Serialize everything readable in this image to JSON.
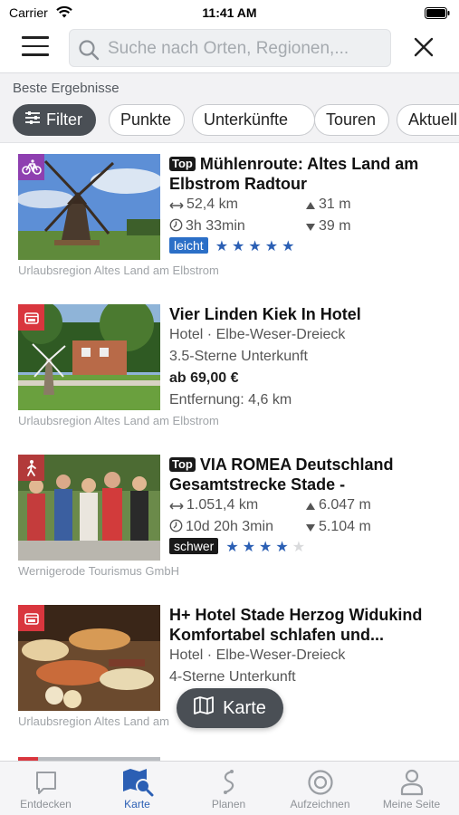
{
  "status_bar": {
    "carrier": "Carrier",
    "time": "11:41 AM"
  },
  "search": {
    "placeholder": "Suche nach Orten, Regionen,..."
  },
  "results": {
    "title": "Beste Ergebnisse",
    "chips": [
      {
        "label": "Filter",
        "active": true
      },
      {
        "label": "Punkte",
        "active": false
      },
      {
        "label": "Unterkünfte",
        "active": false
      },
      {
        "label": "Touren",
        "active": false
      },
      {
        "label": "Aktuell",
        "active": false
      }
    ]
  },
  "items": [
    {
      "kind": "tour",
      "badge_color": "#8e3fb0",
      "badge_icon": "bike-icon",
      "top": "Top",
      "title": "Mühlenroute: Altes Land am Elbstrom Radtour",
      "distance": "52,4 km",
      "duration": "3h 33min",
      "ascent": "31 m",
      "descent": "39 m",
      "difficulty": "leicht",
      "difficulty_color": "#2b6fc7",
      "rating": 5,
      "source": "Urlaubsregion Altes Land am Elbstrom"
    },
    {
      "kind": "hotel",
      "badge_color": "#d9363e",
      "badge_icon": "bed-icon",
      "title": "Vier Linden Kiek In Hotel",
      "category": "Hotel · Elbe-Weser-Dreieck",
      "stars_text": "3.5-Sterne Unterkunft",
      "price": "ab 69,00 €",
      "distance_text": "Entfernung: 4,6 km",
      "source": "Urlaubsregion Altes Land am Elbstrom"
    },
    {
      "kind": "tour",
      "badge_color": "#b23a3a",
      "badge_icon": "hiker-icon",
      "top": "Top",
      "title": "VIA ROMEA Deutschland Gesamtstrecke Stade -",
      "distance": "1.051,4 km",
      "duration": "10d 20h 3min",
      "ascent": "6.047 m",
      "descent": "5.104 m",
      "difficulty": "schwer",
      "difficulty_color": "#1a1a1a",
      "rating": 4,
      "source": "Wernigerode Tourismus GmbH"
    },
    {
      "kind": "hotel",
      "badge_color": "#d9363e",
      "badge_icon": "bed-icon",
      "title": "H+ Hotel Stade Herzog Widukind Komfortabel schlafen und...",
      "category": "Hotel · Elbe-Weser-Dreieck",
      "stars_text": "4-Sterne Unterkunft",
      "source": "Urlaubsregion Altes Land am"
    }
  ],
  "map_button": {
    "label": "Karte"
  },
  "tabbar": [
    {
      "label": "Entdecken",
      "icon": "speech-bubble-icon",
      "active": false
    },
    {
      "label": "Karte",
      "icon": "map-search-icon",
      "active": true
    },
    {
      "label": "Planen",
      "icon": "route-icon",
      "active": false
    },
    {
      "label": "Aufzeichnen",
      "icon": "record-icon",
      "active": false
    },
    {
      "label": "Meine Seite",
      "icon": "user-icon",
      "active": false
    }
  ],
  "colors": {
    "accent": "#2b5fb4",
    "chip_active": "#4a4f55",
    "star": "#2b5fb4"
  }
}
